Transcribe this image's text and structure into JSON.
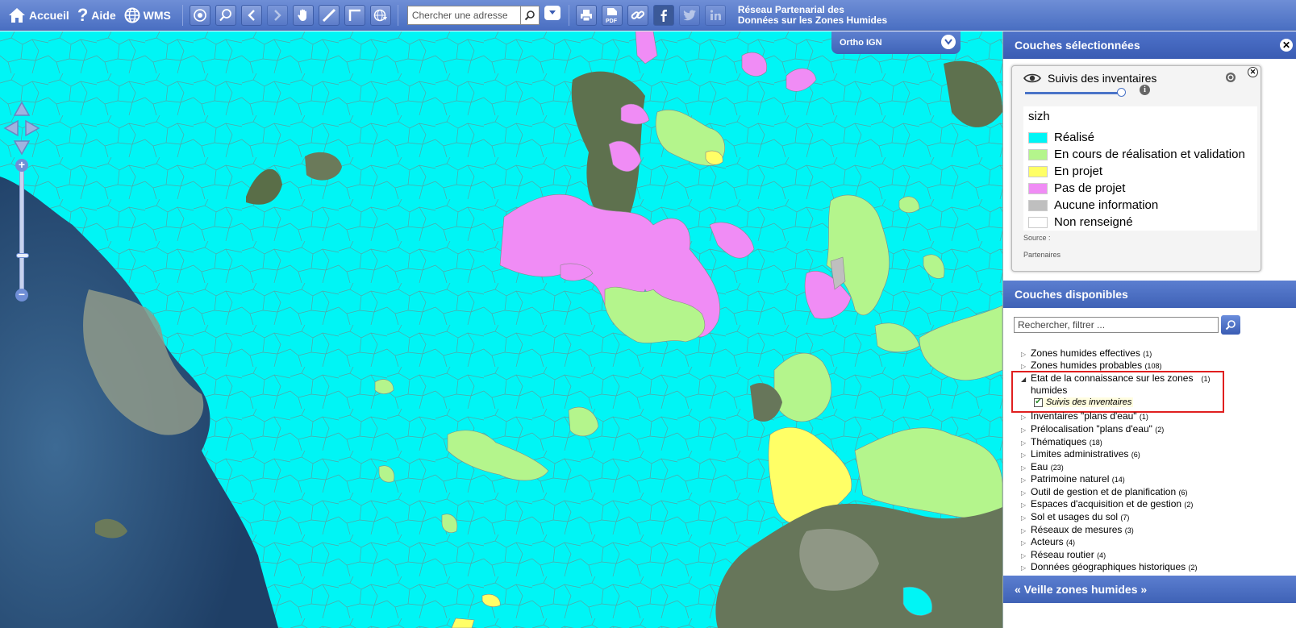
{
  "topbar": {
    "home_label": "Accueil",
    "help_label": "Aide",
    "wms_label": "WMS",
    "search": {
      "placeholder": "Chercher une adresse",
      "value": ""
    },
    "site_title_line1": "Réseau Partenarial des",
    "site_title_line2": "Données sur les Zones Humides",
    "tools": [
      "target-icon",
      "zoom-box-icon",
      "back-icon",
      "forward-icon",
      "pan-hand-icon",
      "measure-ruler-icon",
      "measure-area-icon",
      "globe-icon",
      "print-icon",
      "pdf-icon",
      "link-icon",
      "facebook-icon",
      "twitter-icon",
      "linkedin-icon"
    ]
  },
  "map": {
    "basemap_label": "Ortho IGN",
    "colors": {
      "realise": "#00f5f5",
      "en_cours": "#b4f58c",
      "en_projet": "#ffff66",
      "pas_de_projet": "#f08cf5",
      "aucune": "#bfbfbf",
      "non_renseigne": "#ffffff",
      "sea": "#2f5b8a",
      "land": "#6b7a5a"
    }
  },
  "selected_layers": {
    "header": "Couches sélectionnées",
    "layer": {
      "name": "Suivis des inventaires",
      "opacity": 1.0,
      "legend_title": "sizh",
      "legend": [
        {
          "label": "Réalisé",
          "color": "#00f5f5"
        },
        {
          "label": "En cours de réalisation et validation",
          "color": "#b4f58c"
        },
        {
          "label": "En projet",
          "color": "#ffff66"
        },
        {
          "label": "Pas de projet",
          "color": "#f08cf5"
        },
        {
          "label": "Aucune information",
          "color": "#bfbfbf"
        },
        {
          "label": "Non renseigné",
          "color": "#ffffff"
        }
      ],
      "source_label": "Source :",
      "source_value": "Partenaires"
    }
  },
  "available_layers": {
    "header": "Couches disponibles",
    "filter_placeholder": "Rechercher, filtrer ...",
    "items": [
      {
        "label": "Zones humides effectives",
        "count": "(1)"
      },
      {
        "label": "Zones humides probables",
        "count": "(108)"
      },
      {
        "label": "Etat de la connaissance sur les zones",
        "label2": "humides",
        "count": "(1)",
        "expanded": true
      },
      {
        "label": "Inventaires \"plans d'eau\"",
        "count": "(1)"
      },
      {
        "label": "Prélocalisation \"plans d'eau\"",
        "count": "(2)"
      },
      {
        "label": "Thématiques",
        "count": "(18)"
      },
      {
        "label": "Limites administratives",
        "count": "(6)"
      },
      {
        "label": "Eau",
        "count": "(23)"
      },
      {
        "label": "Patrimoine naturel",
        "count": "(14)"
      },
      {
        "label": "Outil de gestion et de planification",
        "count": "(6)"
      },
      {
        "label": "Espaces d'acquisition et de gestion",
        "count": "(2)"
      },
      {
        "label": "Sol et usages du sol",
        "count": "(7)"
      },
      {
        "label": "Réseaux de mesures",
        "count": "(3)"
      },
      {
        "label": "Acteurs",
        "count": "(4)"
      },
      {
        "label": "Réseau routier",
        "count": "(4)"
      },
      {
        "label": "Données géographiques historiques",
        "count": "(2)"
      }
    ],
    "sub_item": {
      "label": "Suivis des inventaires",
      "checked": true
    }
  },
  "veille": {
    "header": "« Veille zones humides »"
  }
}
